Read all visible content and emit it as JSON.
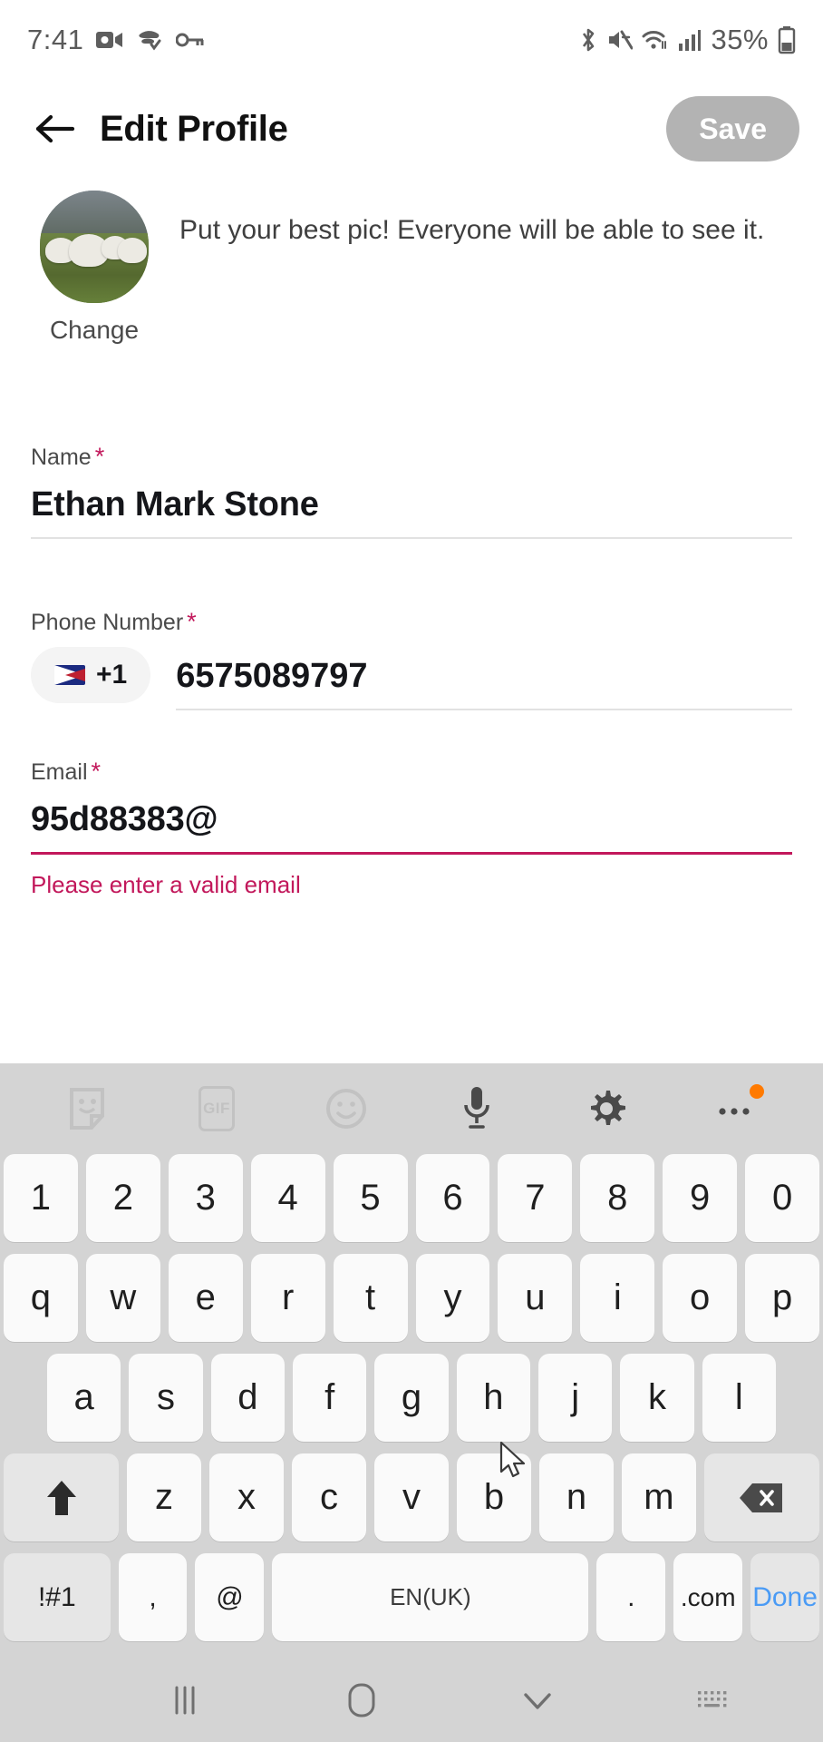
{
  "status_bar": {
    "time": "7:41",
    "battery_percent": "35%",
    "left_icons": [
      "video-camera-icon",
      "shield-check-icon",
      "key-icon"
    ],
    "right_icons": [
      "bluetooth-icon",
      "mute-icon",
      "wifi-icon",
      "cellular-signal-icon",
      "battery-icon"
    ]
  },
  "app_bar": {
    "back_icon": "back-arrow-icon",
    "title": "Edit Profile",
    "save_label": "Save",
    "save_disabled_color": "#b3b3b3"
  },
  "profile": {
    "avatar_change_label": "Change",
    "hint": "Put your best pic! Everyone will be able to see it."
  },
  "form": {
    "required_marker": "*",
    "required_color": "#c2185b",
    "name": {
      "label": "Name",
      "value": "Ethan Mark Stone"
    },
    "phone": {
      "label": "Phone Number",
      "country_code": "+1",
      "flag": "american-samoa-flag-icon",
      "value": "6575089797"
    },
    "email": {
      "label": "Email",
      "value": "95d88383@",
      "error": "Please enter a valid email",
      "error_color": "#c2185b"
    }
  },
  "keyboard": {
    "toolbar": [
      {
        "name": "sticker-icon",
        "label": ""
      },
      {
        "name": "gif-icon",
        "label": "GIF"
      },
      {
        "name": "emoji-icon",
        "label": ""
      },
      {
        "name": "microphone-icon",
        "label": ""
      },
      {
        "name": "gear-icon",
        "label": ""
      },
      {
        "name": "more-options-icon",
        "label": ""
      }
    ],
    "rows": {
      "numbers": [
        "1",
        "2",
        "3",
        "4",
        "5",
        "6",
        "7",
        "8",
        "9",
        "0"
      ],
      "top": [
        "q",
        "w",
        "e",
        "r",
        "t",
        "y",
        "u",
        "i",
        "o",
        "p"
      ],
      "home": [
        "a",
        "s",
        "d",
        "f",
        "g",
        "h",
        "j",
        "k",
        "l"
      ],
      "bottom": [
        "z",
        "x",
        "c",
        "v",
        "b",
        "n",
        "m"
      ],
      "shift_icon": "shift-icon",
      "backspace_icon": "backspace-icon"
    },
    "function_row": {
      "symbols": "!#1",
      "comma": ",",
      "at": "@",
      "space_label": "EN(UK)",
      "period": ".",
      "dotcom": ".com",
      "done": "Done",
      "done_color": "#4a9bf5"
    }
  },
  "nav_bar": {
    "recents_icon": "recents-icon",
    "home_icon": "home-icon",
    "back_icon": "chevron-down-icon",
    "keyboard_switch_icon": "keyboard-switch-icon"
  }
}
